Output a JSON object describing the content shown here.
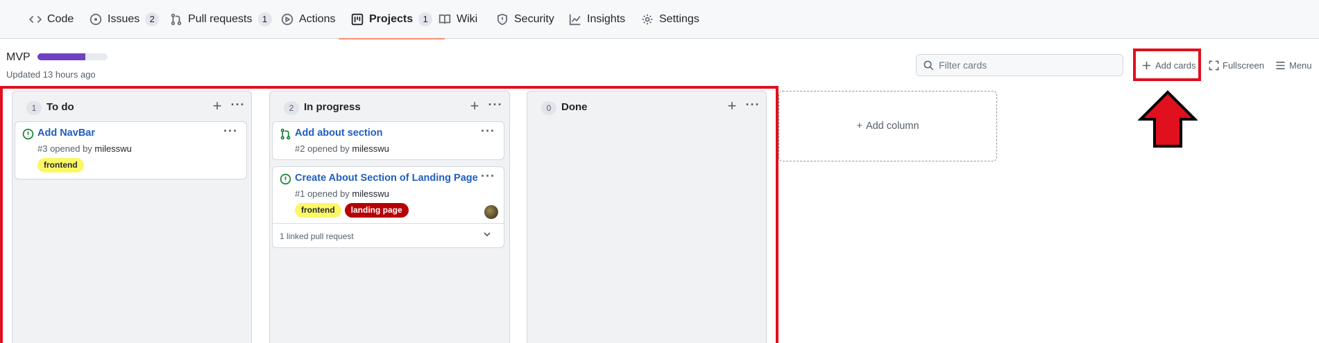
{
  "nav": {
    "items": [
      {
        "label": "Code",
        "icon": "code-icon"
      },
      {
        "label": "Issues",
        "icon": "issue-icon",
        "count": "2"
      },
      {
        "label": "Pull requests",
        "icon": "pull-request-icon",
        "count": "1"
      },
      {
        "label": "Actions",
        "icon": "play-icon"
      },
      {
        "label": "Projects",
        "icon": "project-icon",
        "count": "1",
        "active": true
      },
      {
        "label": "Wiki",
        "icon": "book-icon"
      },
      {
        "label": "Security",
        "icon": "shield-icon"
      },
      {
        "label": "Insights",
        "icon": "graph-icon"
      },
      {
        "label": "Settings",
        "icon": "gear-icon"
      }
    ]
  },
  "project": {
    "title": "MVP",
    "progress_percent": 68,
    "progress_color": "#6f42c1",
    "updated": "Updated 13 hours ago"
  },
  "toolbar": {
    "filter_placeholder": "Filter cards",
    "add_cards": "Add cards",
    "fullscreen": "Fullscreen",
    "menu": "Menu"
  },
  "columns": [
    {
      "count": "1",
      "name": "To do",
      "cards": [
        {
          "title": "Add NavBar",
          "meta_prefix": "#3 opened by",
          "author": "milesswu",
          "labels": [
            "frontend"
          ],
          "type": "issue"
        }
      ]
    },
    {
      "count": "2",
      "name": "In progress",
      "cards": [
        {
          "title": "Add about section",
          "meta_prefix": "#2 opened by",
          "author": "milesswu",
          "labels": [],
          "type": "pull-request"
        },
        {
          "title": "Create About Section of Landing Page",
          "meta_prefix": "#1 opened by",
          "author": "milesswu",
          "labels": [
            "frontend",
            "landing page"
          ],
          "type": "issue",
          "linked": "1 linked pull request"
        }
      ]
    },
    {
      "count": "0",
      "name": "Done",
      "cards": []
    }
  ],
  "add_column": "Add column",
  "colors": {
    "annotation": "#e0101e",
    "label_frontend": "#fbf767",
    "label_landing_page": "#b60205",
    "link": "#1f5fbf"
  }
}
